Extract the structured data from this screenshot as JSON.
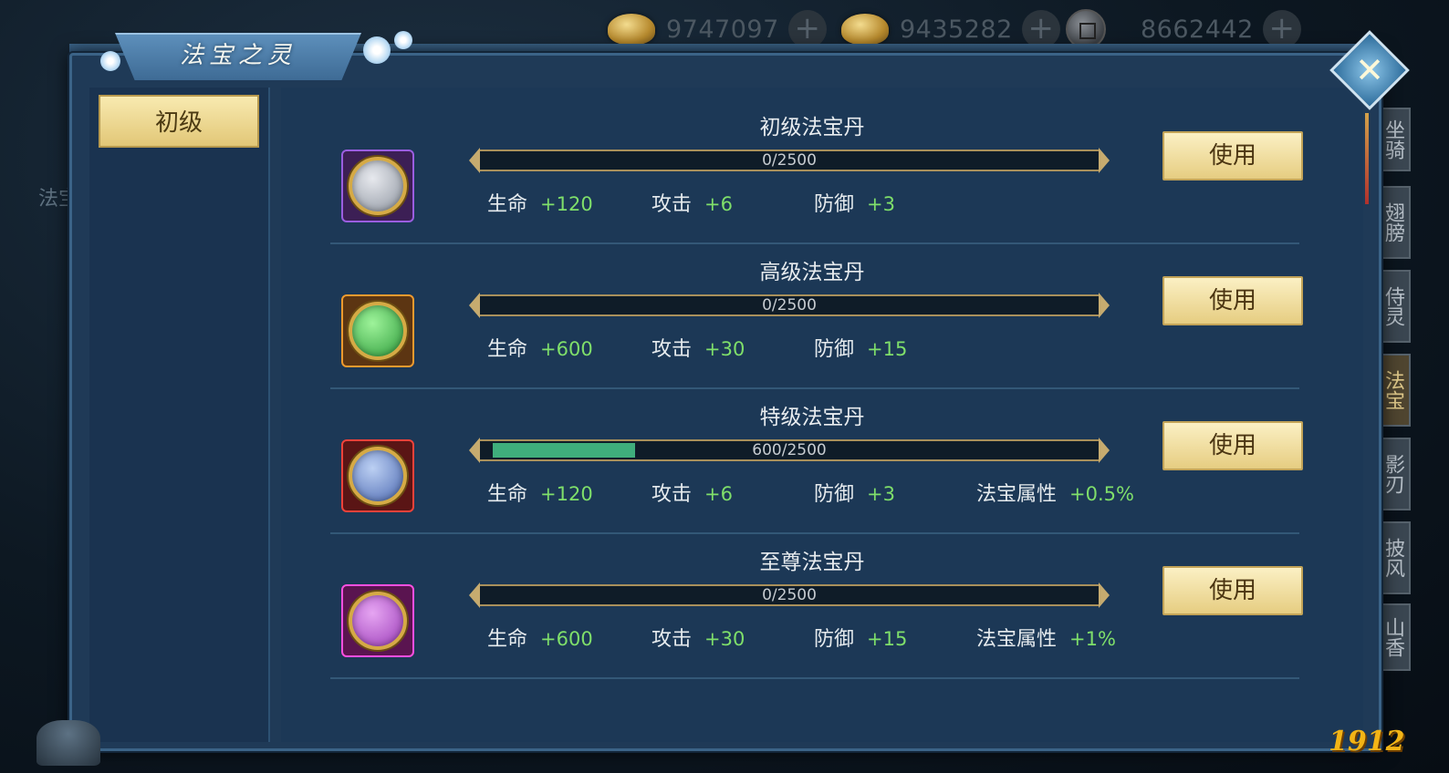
{
  "header": {
    "currencies": [
      {
        "icon": "gold-ingot-icon",
        "value": "9747097"
      },
      {
        "icon": "gold-ingot-icon",
        "value": "9435282"
      },
      {
        "icon": "copper-coin-icon",
        "value": "8662442"
      }
    ]
  },
  "window": {
    "title": "法宝之灵",
    "close_icon": "close-icon"
  },
  "tabs": [
    {
      "label": "初级",
      "selected": true
    }
  ],
  "side_tabs": [
    "坐骑",
    "翅膀",
    "侍灵",
    "法宝",
    "影刃",
    "披风",
    "山香"
  ],
  "side_left_label": "法宝",
  "items": [
    {
      "name": "初级法宝丹",
      "rarity_color": "#8d4fd1",
      "progress_text": "0/2500",
      "progress_fraction": 0,
      "stats": [
        {
          "label": "生命",
          "value": "+120"
        },
        {
          "label": "攻击",
          "value": "+6"
        },
        {
          "label": "防御",
          "value": "+3"
        }
      ],
      "button": "使用"
    },
    {
      "name": "高级法宝丹",
      "rarity_color": "#e08a24",
      "progress_text": "0/2500",
      "progress_fraction": 0,
      "stats": [
        {
          "label": "生命",
          "value": "+600"
        },
        {
          "label": "攻击",
          "value": "+30"
        },
        {
          "label": "防御",
          "value": "+15"
        }
      ],
      "button": "使用"
    },
    {
      "name": "特级法宝丹",
      "rarity_color": "#e0322c",
      "progress_text": "600/2500",
      "progress_fraction": 0.24,
      "stats": [
        {
          "label": "生命",
          "value": "+120"
        },
        {
          "label": "攻击",
          "value": "+6"
        },
        {
          "label": "防御",
          "value": "+3"
        },
        {
          "label": "法宝属性",
          "value": "+0.5%"
        }
      ],
      "button": "使用"
    },
    {
      "name": "至尊法宝丹",
      "rarity_color": "#e03cc8",
      "progress_text": "0/2500",
      "progress_fraction": 0,
      "stats": [
        {
          "label": "生命",
          "value": "+600"
        },
        {
          "label": "攻击",
          "value": "+30"
        },
        {
          "label": "防御",
          "value": "+15"
        },
        {
          "label": "法宝属性",
          "value": "+1%"
        }
      ],
      "button": "使用"
    }
  ],
  "watermark": "1912"
}
